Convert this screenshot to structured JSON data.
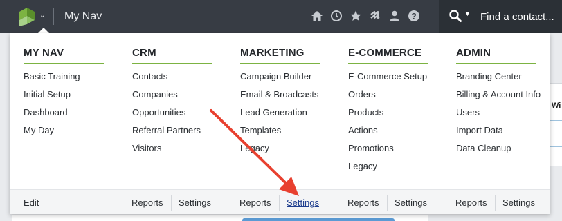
{
  "header": {
    "app_title": "My Nav",
    "search_placeholder": "Find a contact...",
    "icons": [
      "home-icon",
      "clock-icon",
      "star-icon",
      "hashtag-icon",
      "user-icon",
      "help-icon"
    ]
  },
  "menu": {
    "columns": [
      {
        "title": "MY NAV",
        "items": [
          "Basic Training",
          "Initial Setup",
          "Dashboard",
          "My Day"
        ]
      },
      {
        "title": "CRM",
        "items": [
          "Contacts",
          "Companies",
          "Opportunities",
          "Referral Partners",
          "Visitors"
        ]
      },
      {
        "title": "MARKETING",
        "items": [
          "Campaign Builder",
          "Email & Broadcasts",
          "Lead Generation",
          "Templates",
          "Legacy"
        ]
      },
      {
        "title": "E-COMMERCE",
        "items": [
          "E-Commerce Setup",
          "Orders",
          "Products",
          "Actions",
          "Promotions",
          "Legacy"
        ]
      },
      {
        "title": "ADMIN",
        "items": [
          "Branding Center",
          "Billing & Account Info",
          "Users",
          "Import Data",
          "Data Cleanup"
        ]
      }
    ],
    "footer": {
      "mynav_edit": "Edit",
      "crm_reports": "Reports",
      "crm_settings": "Settings",
      "marketing_reports": "Reports",
      "marketing_settings": "Settings",
      "ecommerce_reports": "Reports",
      "ecommerce_settings": "Settings",
      "admin_reports": "Reports",
      "admin_settings": "Settings"
    }
  },
  "background": {
    "table_header_fragment": "Wi"
  },
  "colors": {
    "topbar": "#373c44",
    "accent_green": "#7cb342",
    "annotation_red": "#e8402f",
    "active_link": "#1f3f8f"
  }
}
